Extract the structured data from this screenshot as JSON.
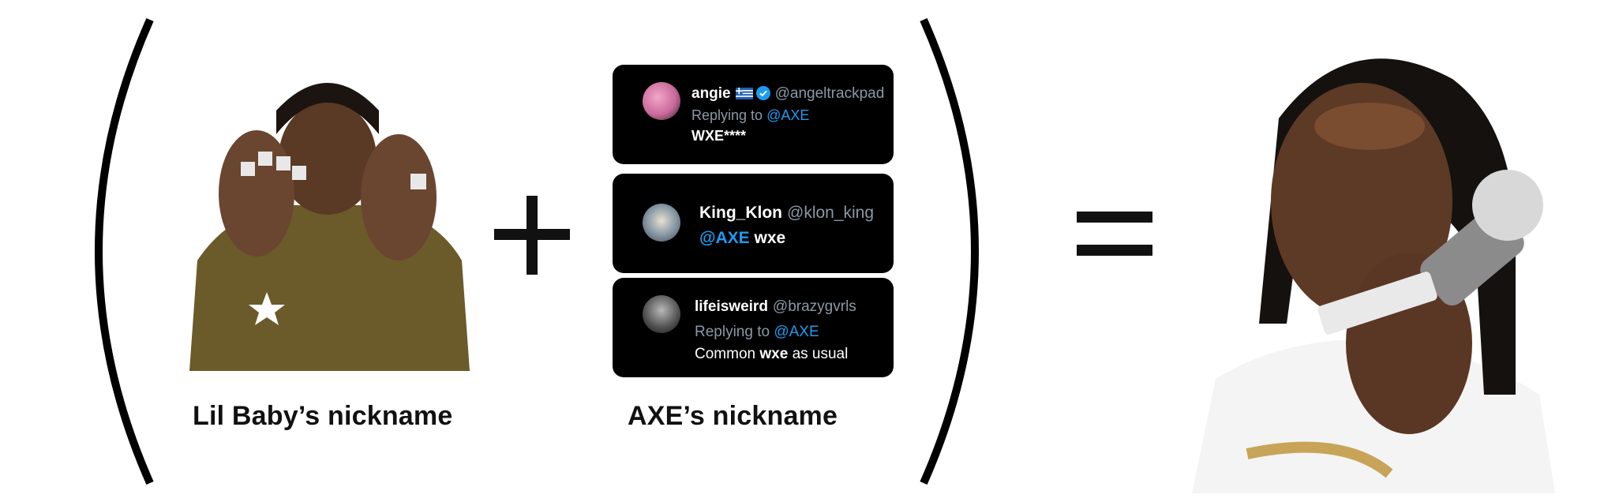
{
  "captions": {
    "left": "Lil Baby’s nickname",
    "right": "AXE’s nickname"
  },
  "images": {
    "left_photo": "Lil Baby photo with WHAMP rings",
    "right_photo": "Lil Baby photo with WHAXE ring"
  },
  "tweets": [
    {
      "name": "angie",
      "handle": "@angeltrackpad",
      "reply_prefix": "Replying to",
      "reply_to": "@AXE",
      "text": "WXE****",
      "icons": [
        "greek-flag-icon",
        "verified-badge-icon"
      ]
    },
    {
      "name": "King_Klon",
      "handle": "@klon_king",
      "mention": "@AXE",
      "text": "wxe"
    },
    {
      "name": "lifeisweird",
      "handle": "@brazygvrls",
      "reply_prefix": "Replying to",
      "reply_to": "@AXE",
      "text_prefix": "Common",
      "text_bold": "wxe",
      "text_suffix": "as usual"
    }
  ],
  "colors": {
    "background": "#ffffff",
    "tweet_bg": "#000000",
    "mention": "#1d9bf0",
    "muted": "#8b98a5"
  }
}
